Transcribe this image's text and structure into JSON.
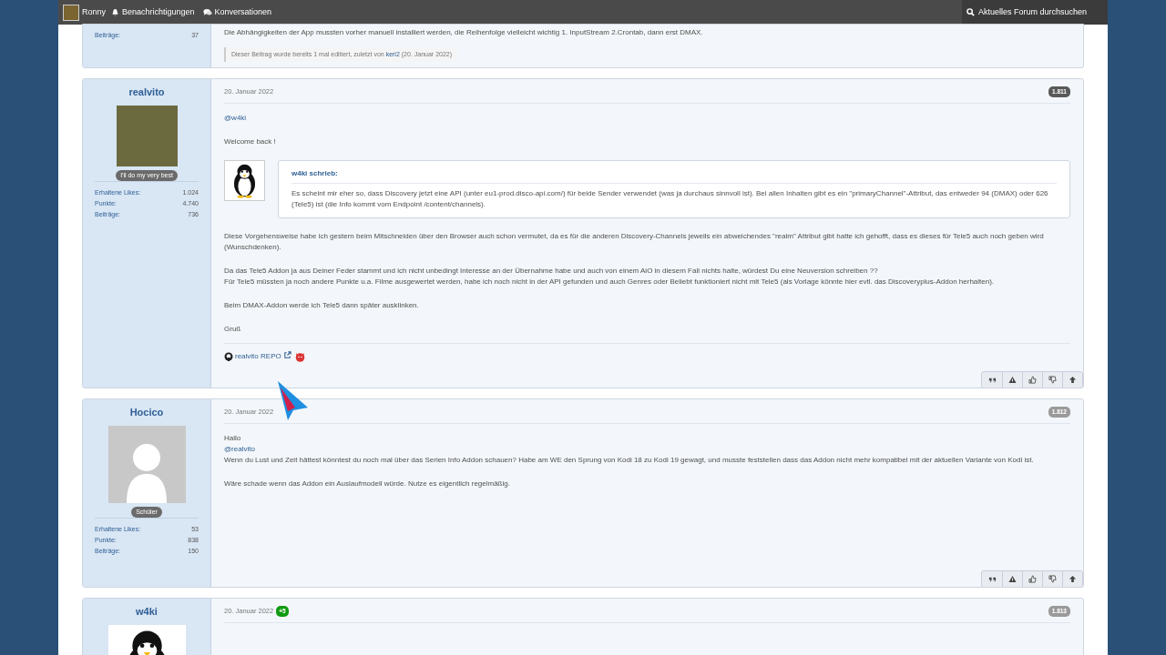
{
  "top_bar": {
    "user": "Ronny",
    "items": [
      {
        "kind": "bell",
        "label": "Benachrichtigungen"
      },
      {
        "kind": "chat",
        "label": "Konversationen"
      }
    ],
    "search": "Aktuelles Forum durchsuchen"
  },
  "posts": [
    {
      "kind": "partial",
      "stats": [
        {
          "label": "Beiträge:",
          "value": "37"
        }
      ],
      "body": [
        [
          [
            {
              "kind": "text",
              "text": "Die Abhängigkeiten der App mussten vorher manuell installiert werden, die Reihenfolge vielleicht wichtig 1. InputStream 2.Crontab, dann erst DMAX."
            }
          ]
        ]
      ],
      "edit_note": [
        {
          "kind": "text",
          "text": "Dieser Beitrag wurde bereits 1 mal editiert, zuletzt von "
        },
        {
          "kind": "link",
          "text": "keri2"
        },
        {
          "kind": "text",
          "text": " (20. Januar 2022)"
        }
      ]
    },
    {
      "kind": "full",
      "author": "realvito",
      "avatar": {
        "kind": "photo"
      },
      "user_title": "I'll do my very best",
      "stats": [
        {
          "label": "Erhaltene Likes:",
          "value": "1.024"
        },
        {
          "label": "Punkte:",
          "value": "4.740"
        },
        {
          "label": "Beiträge:",
          "value": "736"
        }
      ],
      "date": "20. Januar 2022",
      "number": "1.811",
      "number_dark": true,
      "body": [
        [
          [
            {
              "kind": "link",
              "text": "@w4ki"
            }
          ]
        ],
        [
          [
            {
              "kind": "text",
              "text": "Welcome back !"
            }
          ]
        ],
        {
          "quote": {
            "author": "w4ki schrieb:",
            "text": "Es scheint mir eher so, dass Discovery jetzt eine API (unter eu1-prod.disco-api.com/) für beide Sender verwendet (was ja durchaus sinnvoll ist). Bei allen Inhalten gibt es ein \"primaryChannel\"-Attribut, das entweder 94 (DMAX) oder 626 (Tele5) ist (die Info kommt vom Endpoint /content/channels)."
          }
        },
        [
          [
            {
              "kind": "text",
              "text": "Diese Vorgehensweise habe ich gestern beim Mitschneiden über den Browser auch schon vermutet, da es für die anderen Discovery-Channels jeweils ein abweichendes \"realm\" Attribut gibt hatte ich gehofft, dass es dieses für Tele5 auch noch geben wird (Wunschdenken)."
            }
          ]
        ],
        [
          [
            {
              "kind": "text",
              "text": "Da das Tele5 Addon ja aus Deiner Feder stammt und ich nicht unbedingt Interesse an der Übernahme habe und auch von einem AiO in diesem Fall nichts halte, würdest Du eine Neuversion schreiben ??"
            }
          ],
          [
            {
              "kind": "text",
              "text": "Für Tele5 müssten ja noch andere Punkte u.a. Filme ausgewertet werden, habe ich noch nicht in der API gefunden und auch Genres oder Beliebt funktioniert nicht mit Tele5 (als Vorlage könnte hier evtl. das Discoveryplus-Addon herhalten)."
            }
          ]
        ],
        [
          [
            {
              "kind": "text",
              "text": "Beim DMAX-Addon werde ich Tele5 dann später ausklinken."
            }
          ]
        ],
        [
          [
            {
              "kind": "text",
              "text": "Gruß"
            }
          ]
        ]
      ],
      "signature": {
        "text": "realvito REPO",
        "external": true
      }
    },
    {
      "kind": "full",
      "author": "Hocico",
      "avatar": {
        "kind": "silhouette"
      },
      "user_title": "Schüler",
      "stats": [
        {
          "label": "Erhaltene Likes:",
          "value": "53"
        },
        {
          "label": "Punkte:",
          "value": "838"
        },
        {
          "label": "Beiträge:",
          "value": "150"
        }
      ],
      "date": "20. Januar 2022",
      "number": "1.812",
      "number_dark": false,
      "body": [
        [
          [
            {
              "kind": "text",
              "text": "Hallo"
            }
          ],
          [
            {
              "kind": "link",
              "text": "@realvito"
            }
          ],
          [
            {
              "kind": "text",
              "text": "Wenn du Lust und Zeit hättest könntest du noch mal über das Serien Info Addon schauen? Habe am WE den Sprung von Kodi 18 zu Kodi 19 gewagt, und musste feststellen dass das Addon nicht mehr kompatibel mit der aktuellen Variante von Kodi ist."
            }
          ]
        ],
        [
          [
            {
              "kind": "text",
              "text": "Wäre schade wenn das Addon ein Auslaufmodell würde. Nutze es eigentlich regelmäßig."
            }
          ]
        ]
      ]
    },
    {
      "kind": "cut",
      "author": "w4ki",
      "avatar": {
        "kind": "penguin"
      },
      "date": "20. Januar 2022",
      "reactions": "+5",
      "number": "1.813",
      "number_dark": false
    }
  ]
}
